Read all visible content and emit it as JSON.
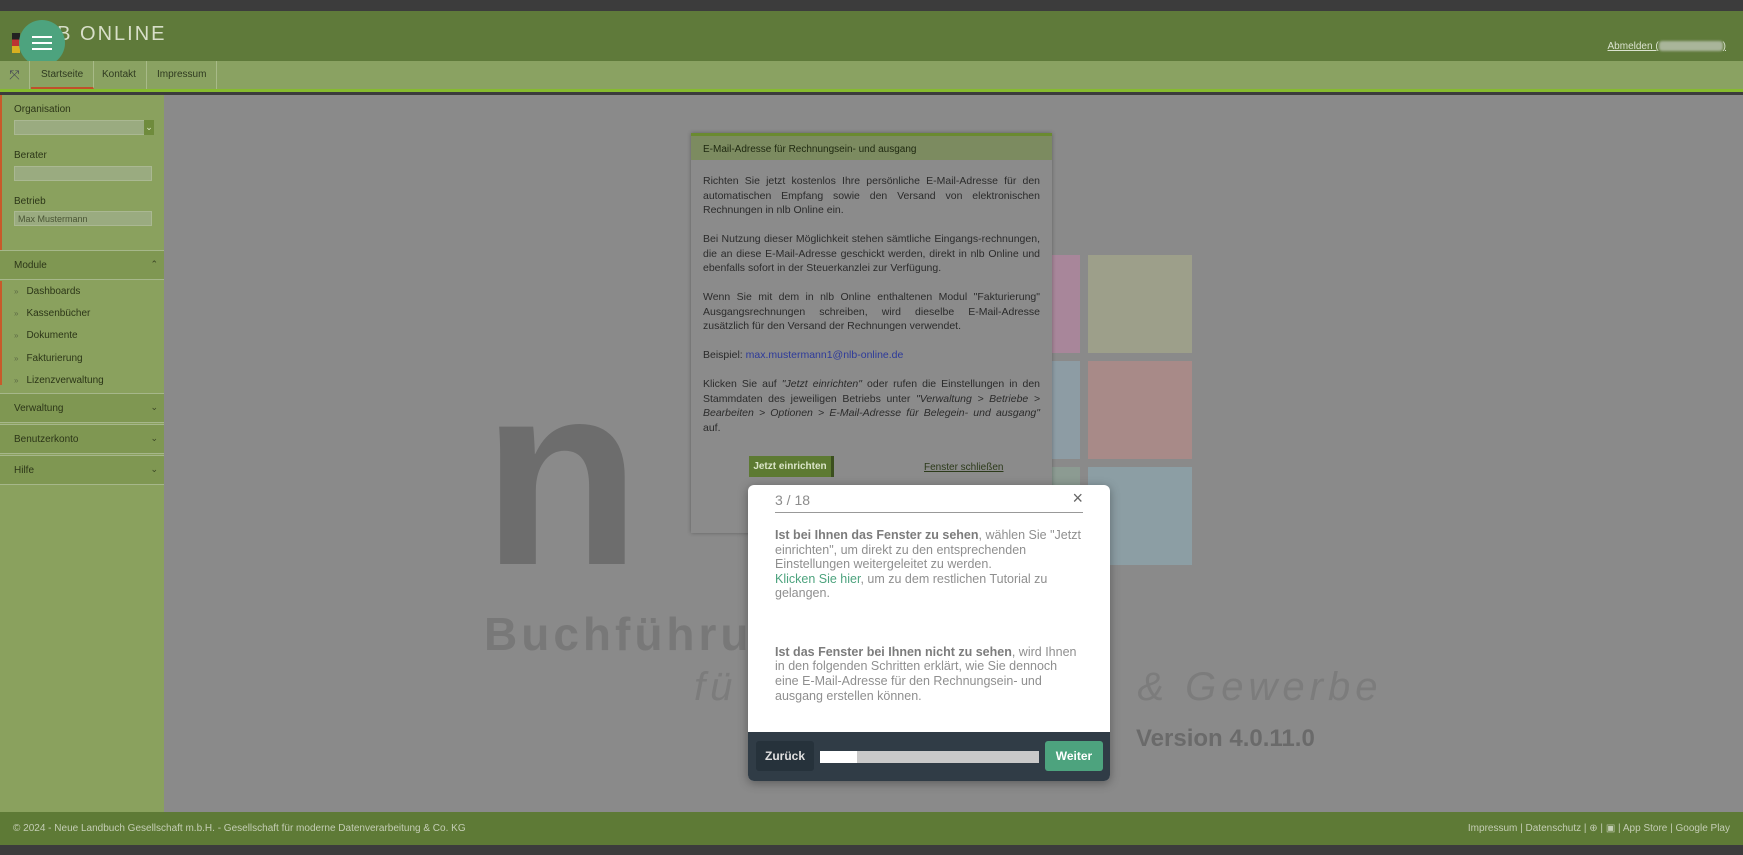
{
  "header": {
    "logo_text": "LB ONLINE",
    "logout_label": "Abmelden ("
  },
  "navbar": {
    "expand_icon": "expand-arrows-icon",
    "tabs": [
      {
        "label": "Startseite"
      },
      {
        "label": "Kontakt"
      },
      {
        "label": "Impressum"
      }
    ]
  },
  "sidebar": {
    "organisation_label": "Organisation",
    "berater_label": "Berater",
    "betrieb_label": "Betrieb",
    "betrieb_value": "Max Mustermann",
    "module_label": "Module",
    "items": [
      {
        "label": "Dashboards"
      },
      {
        "label": "Kassenbücher"
      },
      {
        "label": "Dokumente"
      },
      {
        "label": "Fakturierung"
      },
      {
        "label": "Lizenzverwaltung"
      }
    ],
    "verwaltung_label": "Verwaltung",
    "benutzerkonto_label": "Benutzerkonto",
    "hilfe_label": "Hilfe"
  },
  "background": {
    "watermark_line1": "Buchführu",
    "watermark_line2": "fü",
    "watermark_line2b": "& Gewerbe",
    "version": "Version 4.0.11.0",
    "tile_colors": [
      "#8f8a9c",
      "#a8869a",
      "#9d9f8a",
      "#a39a86",
      "#8d9ca4",
      "#a88a88",
      "#a8888c",
      "#8c9b92",
      "#8c9ea4"
    ]
  },
  "email_modal": {
    "title": "E-Mail-Adresse für Rechnungsein- und ausgang",
    "p1": "Richten Sie jetzt kostenlos Ihre persönliche E-Mail-Adresse für den automatischen Empfang sowie den Versand von elektronischen Rechnungen in nlb Online ein.",
    "p2": "Bei Nutzung dieser Möglichkeit stehen sämtliche Eingangs-rechnungen, die an diese E-Mail-Adresse geschickt werden, direkt in nlb Online und ebenfalls sofort in der Steuerkanzlei zur Verfügung.",
    "p3": "Wenn Sie mit dem in nlb Online enthaltenen Modul \"Fakturierung\" Ausgangsrechnungen schreiben, wird dieselbe E-Mail-Adresse zusätzlich für den Versand der Rechnungen verwendet.",
    "example_label": "Beispiel: ",
    "example_mail": "max.mustermann1@nlb-online.de",
    "p5a": "Klicken Sie auf ",
    "p5b": "\"Jetzt einrichten\"",
    "p5c": " oder rufen die Einstellungen in den Stammdaten des jeweiligen Betriebs unter ",
    "p5d": "\"Verwaltung > Betriebe > Bearbeiten > Optionen > E-Mail-Adresse für Belegein- und ausgang\"",
    "p5e": " auf.",
    "btn_setup": "Jetzt einrichten",
    "btn_close": "Fenster schließen"
  },
  "tour": {
    "counter": "3 / 18",
    "step": 3,
    "total": 18,
    "bold1": "Ist bei Ihnen das Fenster zu sehen",
    "text1": ", wählen Sie \"Jetzt einrichten\", um direkt zu den entsprechenden Einstellungen weitergeleitet zu werden.",
    "link": "Klicken Sie hier",
    "text2": ", um zu dem restlichen Tutorial zu gelangen.",
    "bold2": "Ist das Fenster bei Ihnen nicht zu sehen",
    "text3": ", wird Ihnen in den folgenden Schritten erklärt, wie Sie dennoch eine E-Mail-Adresse für den Rechnungsein- und ausgang erstellen können.",
    "back_label": "Zurück",
    "next_label": "Weiter",
    "progress_fraction": 0.167
  },
  "footer": {
    "copyright": "© 2024 - Neue Landbuch Gesellschaft m.b.H. - Gesellschaft für moderne Datenverarbeitung & Co. KG",
    "impressum": "Impressum",
    "datenschutz": "Datenschutz",
    "app_store": "App Store",
    "google_play": "Google Play"
  }
}
